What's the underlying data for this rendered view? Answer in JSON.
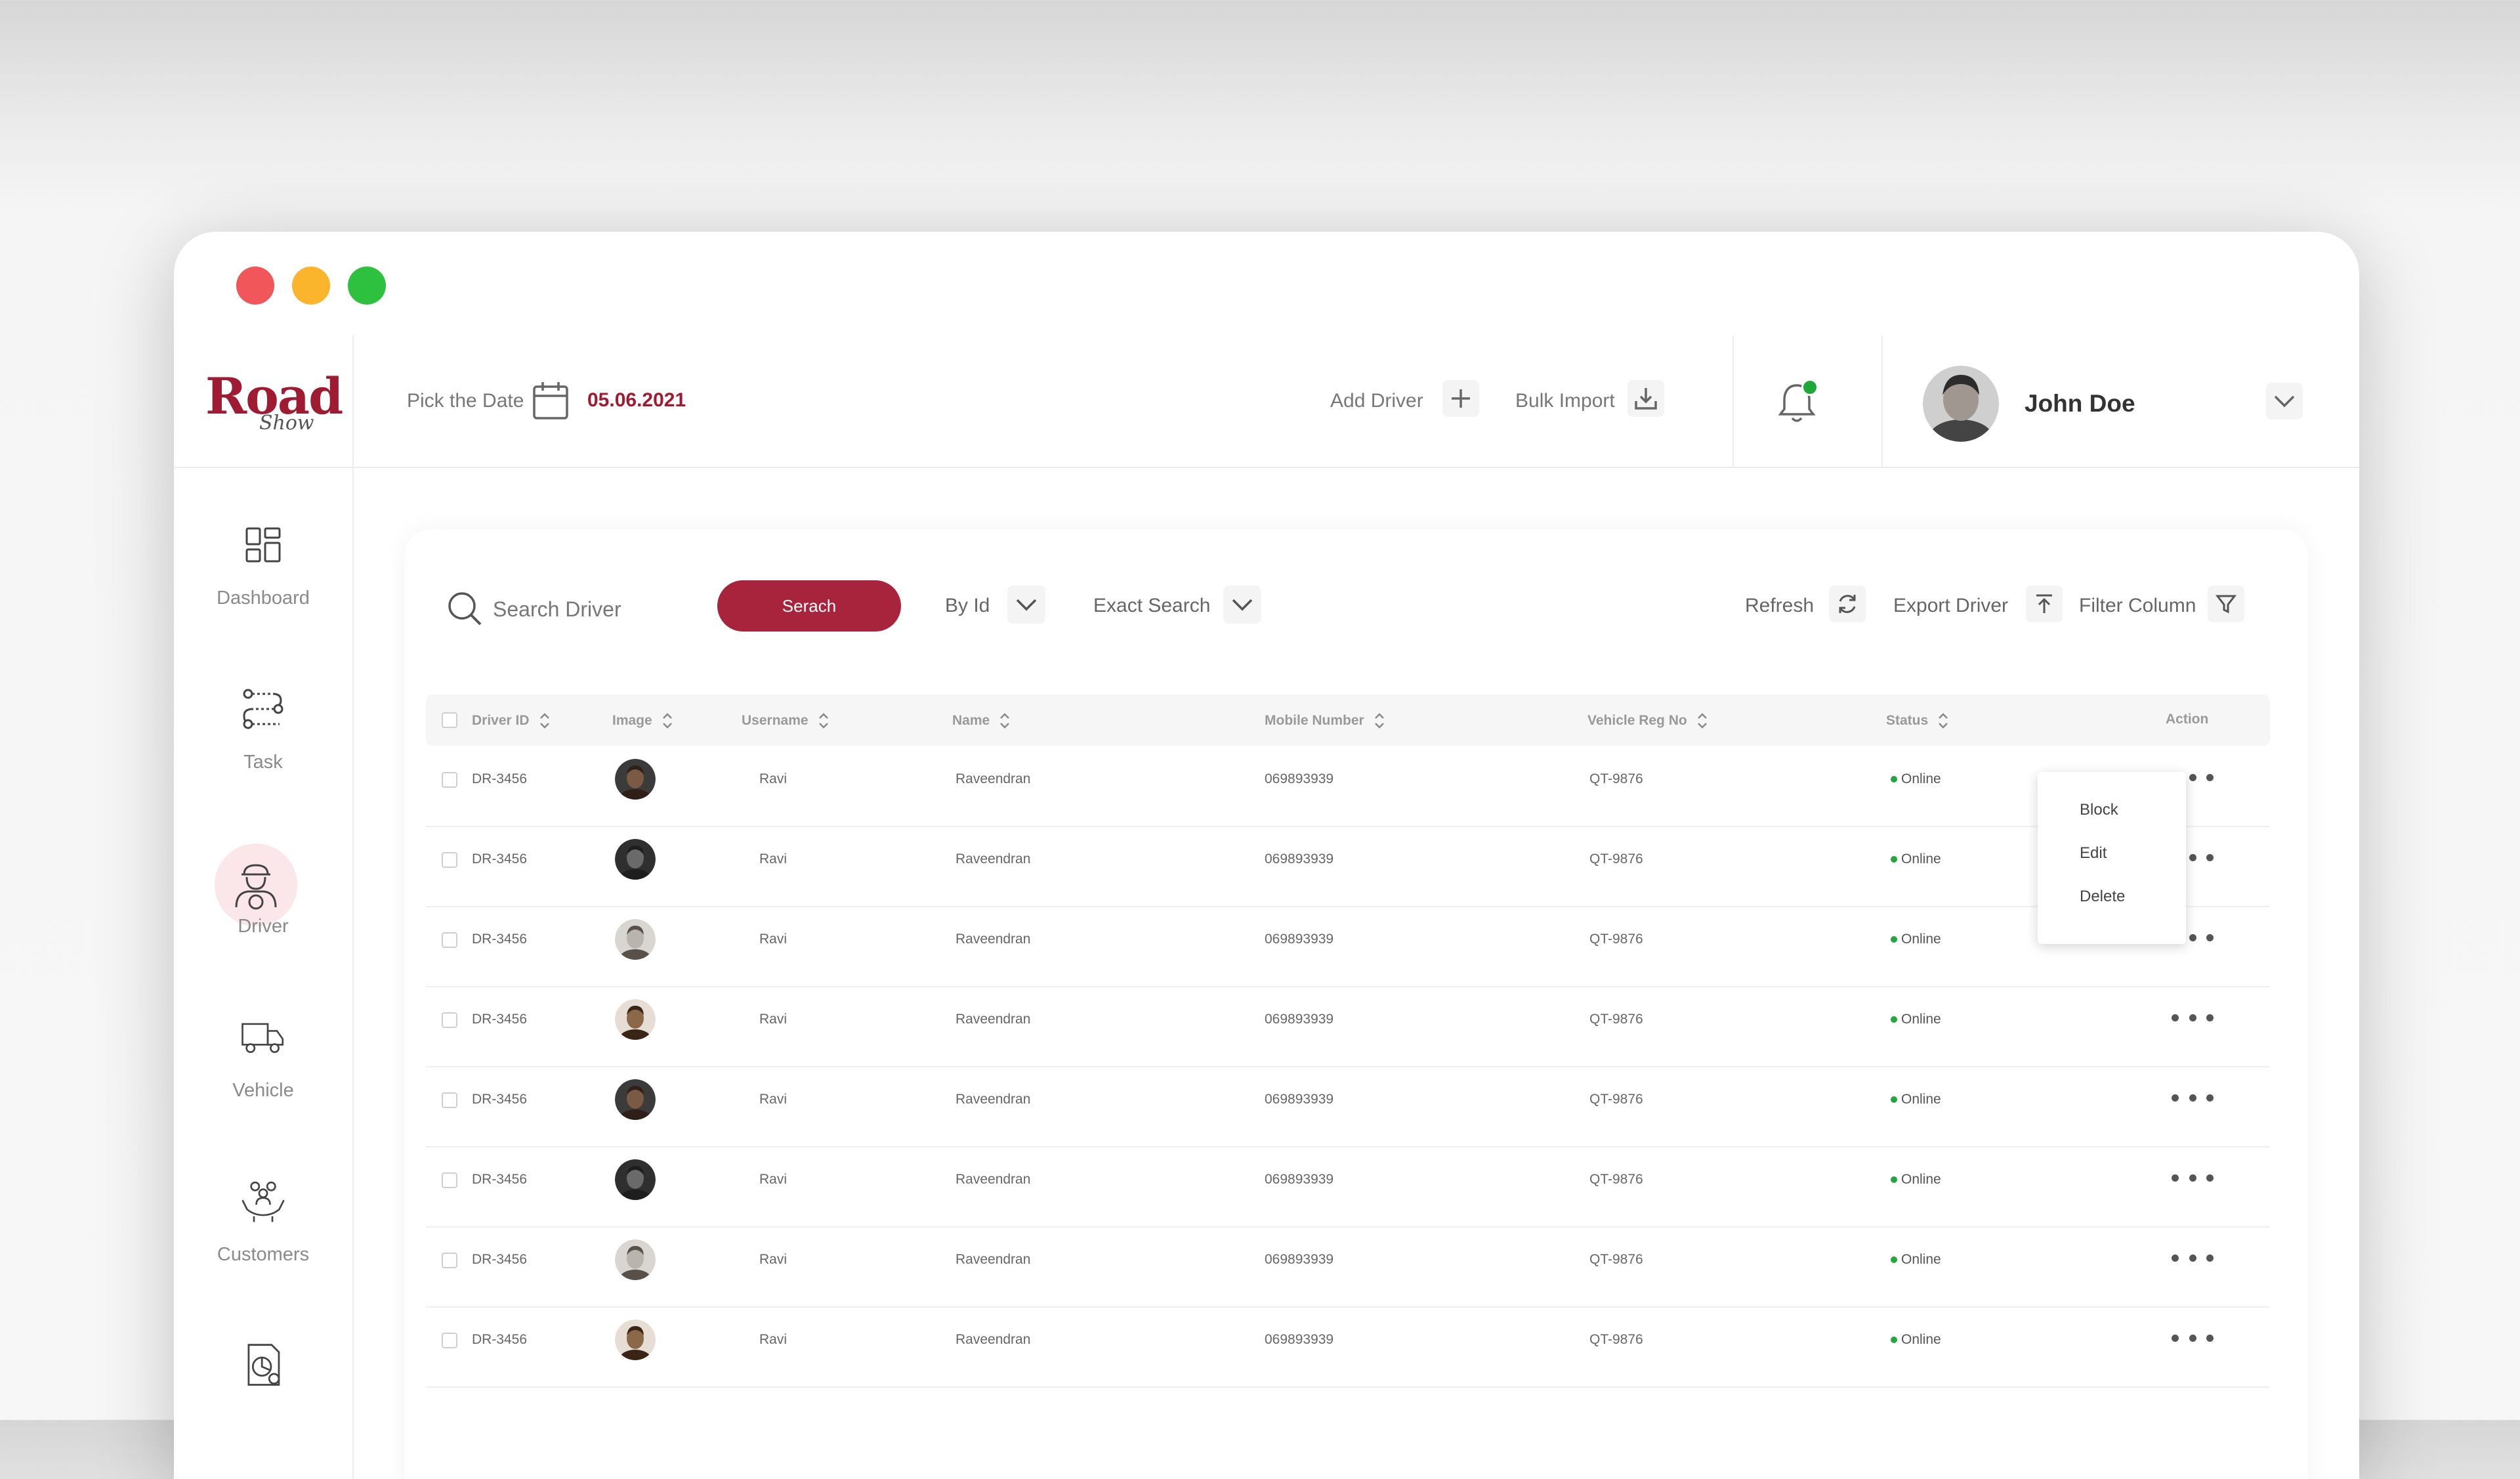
{
  "brand": {
    "name_main": "Road",
    "name_script": "Show"
  },
  "header": {
    "pick_date_label": "Pick the Date",
    "date_value": "05.06.2021",
    "add_driver_label": "Add Driver",
    "bulk_import_label": "Bulk Import",
    "user_name": "John Doe"
  },
  "sidebar": {
    "items": [
      {
        "label": "Dashboard",
        "icon": "dashboard-icon"
      },
      {
        "label": "Task",
        "icon": "task-route-icon"
      },
      {
        "label": "Driver",
        "icon": "driver-icon",
        "active": true
      },
      {
        "label": "Vehicle",
        "icon": "truck-icon"
      },
      {
        "label": "Customers",
        "icon": "customers-icon"
      },
      {
        "label": "",
        "icon": "reports-icon"
      }
    ]
  },
  "toolbar": {
    "search_placeholder": "Search Driver",
    "search_button": "Serach",
    "by_id_label": "By Id",
    "exact_search_label": "Exact Search",
    "refresh_label": "Refresh",
    "export_label": "Export Driver",
    "filter_label": "Filter Column"
  },
  "table": {
    "columns": [
      "Driver ID",
      "Image",
      "Username",
      "Name",
      "Mobile Number",
      "Vehicle Reg No",
      "Status",
      "Action"
    ],
    "rows": [
      {
        "driver_id": "DR-3456",
        "username": "Ravi",
        "name": "Raveendran",
        "mobile": "069893939",
        "vehicle": "QT-9876",
        "status": "Online"
      },
      {
        "driver_id": "DR-3456",
        "username": "Ravi",
        "name": "Raveendran",
        "mobile": "069893939",
        "vehicle": "QT-9876",
        "status": "Online"
      },
      {
        "driver_id": "DR-3456",
        "username": "Ravi",
        "name": "Raveendran",
        "mobile": "069893939",
        "vehicle": "QT-9876",
        "status": "Online"
      },
      {
        "driver_id": "DR-3456",
        "username": "Ravi",
        "name": "Raveendran",
        "mobile": "069893939",
        "vehicle": "QT-9876",
        "status": "Online"
      },
      {
        "driver_id": "DR-3456",
        "username": "Ravi",
        "name": "Raveendran",
        "mobile": "069893939",
        "vehicle": "QT-9876",
        "status": "Online"
      },
      {
        "driver_id": "DR-3456",
        "username": "Ravi",
        "name": "Raveendran",
        "mobile": "069893939",
        "vehicle": "QT-9876",
        "status": "Online"
      },
      {
        "driver_id": "DR-3456",
        "username": "Ravi",
        "name": "Raveendran",
        "mobile": "069893939",
        "vehicle": "QT-9876",
        "status": "Online"
      },
      {
        "driver_id": "DR-3456",
        "username": "Ravi",
        "name": "Raveendran",
        "mobile": "069893939",
        "vehicle": "QT-9876",
        "status": "Online"
      }
    ]
  },
  "action_menu": {
    "items": [
      "Block",
      "Edit",
      "Delete"
    ]
  },
  "colors": {
    "brand": "#9e1b32",
    "button": "#a8243c",
    "online": "#22a73c"
  }
}
